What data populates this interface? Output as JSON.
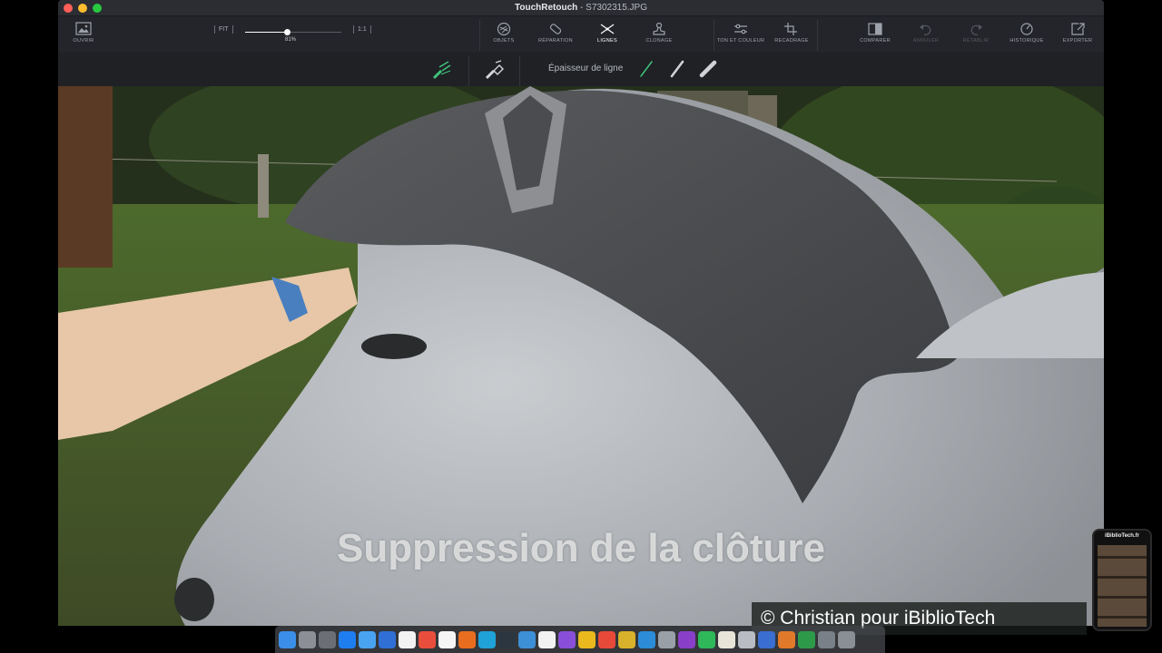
{
  "window": {
    "app_name": "TouchRetouch",
    "file_name": " - S7302315.JPG"
  },
  "toolbar": {
    "open": "OUVRIR",
    "fit": "FIT",
    "zoom_percent": "81%",
    "zoom_value": 0.43,
    "one_to_one": "1:1",
    "tools": [
      {
        "label": "OBJETS",
        "icon": "objects-icon"
      },
      {
        "label": "RÉPARATION",
        "icon": "bandage-icon"
      },
      {
        "label": "LIGNES",
        "icon": "lines-icon"
      },
      {
        "label": "CLONAGE",
        "icon": "stamp-icon"
      },
      {
        "label": "TON ET COULEUR",
        "icon": "sliders-icon"
      },
      {
        "label": "RECADRAGE",
        "icon": "crop-icon"
      }
    ],
    "compare": "COMPARER",
    "undo": "ANNULER",
    "redo": "RÉTABLIR",
    "history": "HISTORIQUE",
    "export": "EXPORTER"
  },
  "subbar": {
    "line_width_label": "Épaisseur de ligne",
    "accent": "#3ec37a"
  },
  "overlay": {
    "caption": "Suppression de la clôture",
    "credit": "© Christian pour iBiblioTech"
  },
  "cam": {
    "title": "iBiblioTech.fr"
  }
}
